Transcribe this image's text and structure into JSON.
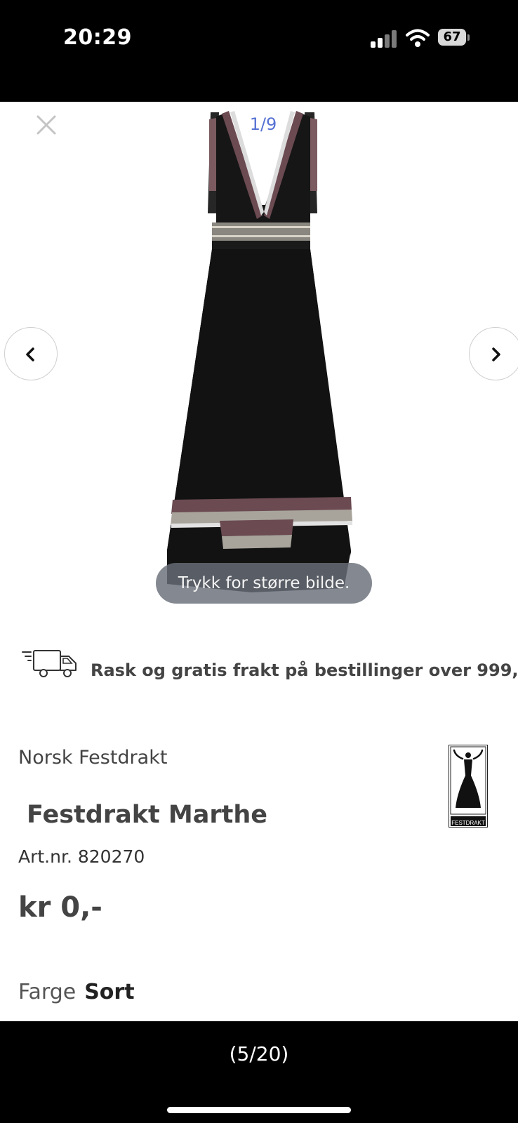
{
  "status_bar": {
    "time": "20:29",
    "battery": "67"
  },
  "gallery": {
    "counter": "1/9",
    "hint": "Trykk for større bilde."
  },
  "shipping": {
    "text": "Rask og gratis frakt på bestillinger over 999,-"
  },
  "product": {
    "brand": "Norsk Festdrakt",
    "name": "Festdrakt Marthe",
    "article_number": "Art.nr. 820270",
    "price": "kr 0,-",
    "color_label": "Farge",
    "color_value": "Sort",
    "logo_text": "FESTDRAKT"
  },
  "footer": {
    "page_count": "(5/20)"
  },
  "icons": [
    "close-icon",
    "chevron-left-icon",
    "chevron-right-icon",
    "truck-icon",
    "wifi-icon",
    "battery-icon",
    "signal-icon"
  ]
}
